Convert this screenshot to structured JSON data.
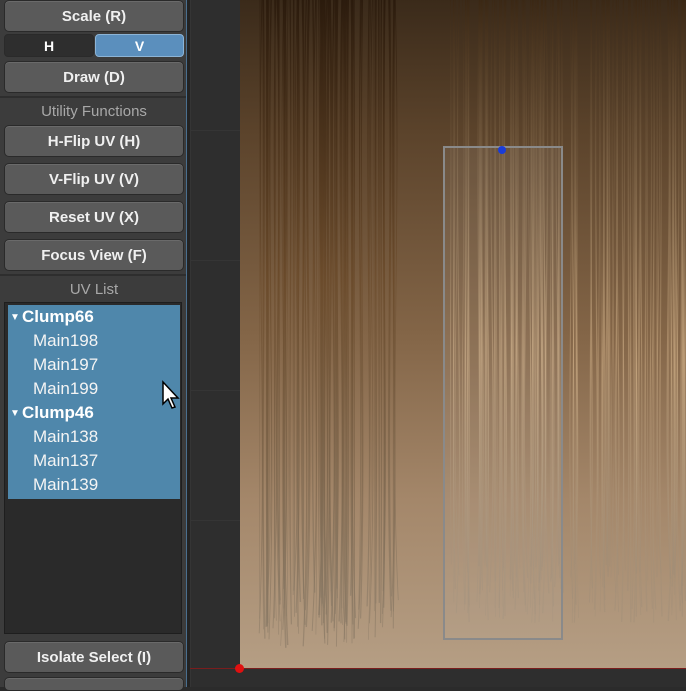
{
  "tools": {
    "scale_label": "Scale (R)",
    "h_label": "H",
    "v_label": "V",
    "draw_label": "Draw (D)"
  },
  "utility": {
    "title": "Utility Functions",
    "hflip_label": "H-Flip UV (H)",
    "vflip_label": "V-Flip UV (V)",
    "reset_label": "Reset UV (X)",
    "focus_label": "Focus View (F)"
  },
  "uv_list": {
    "title": "UV List",
    "groups": [
      {
        "name": "Clump66",
        "items": [
          "Main198",
          "Main197",
          "Main199"
        ]
      },
      {
        "name": "Clump46",
        "items": [
          "Main138",
          "Main137",
          "Main139"
        ]
      }
    ]
  },
  "footer": {
    "isolate_label": "Isolate Select (I)"
  },
  "colors": {
    "accent": "#4f87ab",
    "toggle_active": "#5b8fbd",
    "handle": "#1a3cd8",
    "origin": "#e01010"
  }
}
